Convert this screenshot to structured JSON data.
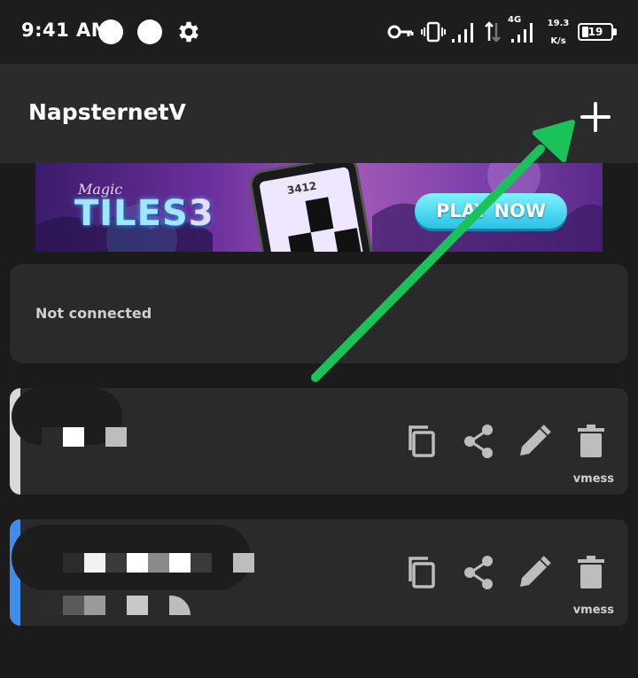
{
  "status_bar": {
    "time": "9:41 AM",
    "net_speed_value": "19.3",
    "net_speed_unit": "K/s",
    "network_type": "4G",
    "battery_level": "19",
    "icons": [
      "circle-icon",
      "circle-icon",
      "gear-icon",
      "vpn-key-icon",
      "vibrate-icon",
      "signal-icon",
      "data-arrows-icon",
      "signal-icon",
      "battery-icon"
    ]
  },
  "app_bar": {
    "title": "NapsternetV",
    "add_icon": "plus-icon"
  },
  "ad": {
    "small_text": "Magic",
    "logo_text": "TILES",
    "logo_number": "3",
    "score": "3412",
    "cta_label": "PLAY NOW"
  },
  "connection": {
    "status": "Not connected"
  },
  "servers": [
    {
      "protocol": "vmess",
      "accent_color": "#d9d9d9",
      "actions": [
        "copy-icon",
        "share-icon",
        "edit-icon",
        "delete-icon"
      ]
    },
    {
      "protocol": "vmess",
      "accent_color": "#3f8de8",
      "actions": [
        "copy-icon",
        "share-icon",
        "edit-icon",
        "delete-icon"
      ]
    }
  ],
  "colors": {
    "background": "#1b1b1b",
    "surface": "#2a2a2a",
    "app_bar": "#2b2b2b",
    "annotation_arrow": "#19c35a"
  }
}
